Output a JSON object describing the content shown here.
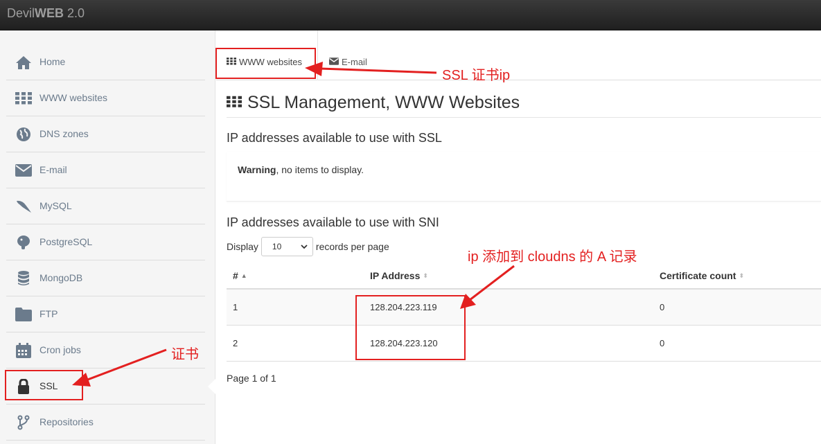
{
  "brand": {
    "prefix": "Devil",
    "bold": "WEB",
    "suffix": " 2.0"
  },
  "sidebar": {
    "items": [
      {
        "label": "Home",
        "icon": "home-icon"
      },
      {
        "label": "WWW websites",
        "icon": "grid-icon"
      },
      {
        "label": "DNS zones",
        "icon": "globe-icon"
      },
      {
        "label": "E-mail",
        "icon": "envelope-icon"
      },
      {
        "label": "MySQL",
        "icon": "dolphin-icon"
      },
      {
        "label": "PostgreSQL",
        "icon": "elephant-icon"
      },
      {
        "label": "MongoDB",
        "icon": "database-icon"
      },
      {
        "label": "FTP",
        "icon": "folder-icon"
      },
      {
        "label": "Cron jobs",
        "icon": "calendar-icon"
      },
      {
        "label": "SSL",
        "icon": "lock-icon",
        "active": true
      },
      {
        "label": "Repositories",
        "icon": "git-branch-icon"
      }
    ]
  },
  "tabs": [
    {
      "label": "WWW websites",
      "icon": "grid-icon",
      "active": true
    },
    {
      "label": "E-mail",
      "icon": "envelope-icon"
    }
  ],
  "page": {
    "title": "SSL Management, WWW Websites",
    "ssl_heading": "IP addresses available to use with SSL",
    "warning_bold": "Warning",
    "warning_rest": ", no items to display.",
    "sni_heading": "IP addresses available to use with SNI",
    "display_label": "Display",
    "page_length": "10",
    "records_label": "records per page",
    "page_info": "Page 1 of 1"
  },
  "table": {
    "columns": [
      "#",
      "IP Address",
      "Certificate count"
    ],
    "rows": [
      {
        "num": "1",
        "ip": "128.204.223.119",
        "count": "0"
      },
      {
        "num": "2",
        "ip": "128.204.223.120",
        "count": "0"
      }
    ]
  },
  "annotations": {
    "ssl_ip": "SSL 证书ip",
    "cert": "证书",
    "cloudns": "ip 添加到 cloudns 的 A 记录",
    "color": "#e32020"
  }
}
